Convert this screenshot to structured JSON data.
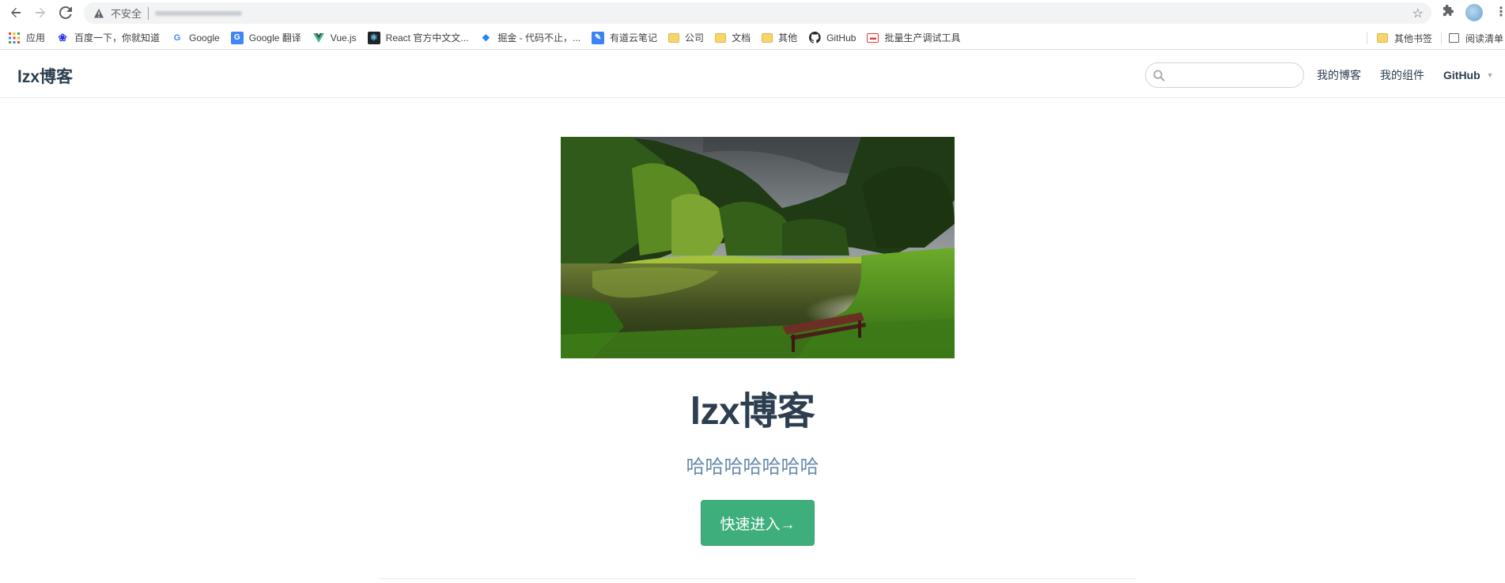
{
  "browser": {
    "insecure_label": "不安全",
    "icons": {
      "back": "back-arrow-icon",
      "forward": "forward-arrow-icon",
      "reload": "reload-icon",
      "warning": "warning-triangle-icon",
      "star": "star-icon",
      "extensions": "puzzle-icon",
      "menu": "kebab-menu-icon"
    }
  },
  "bookmarks": {
    "items": [
      {
        "label": "应用",
        "icon": "apps-grid-icon"
      },
      {
        "label": "百度一下，你就知道",
        "icon": "baidu-icon"
      },
      {
        "label": "Google",
        "icon": "google-icon"
      },
      {
        "label": "Google 翻译",
        "icon": "google-translate-icon"
      },
      {
        "label": "Vue.js",
        "icon": "vue-icon"
      },
      {
        "label": "React 官方中文文...",
        "icon": "react-icon"
      },
      {
        "label": "掘金 - 代码不止，...",
        "icon": "juejin-icon"
      },
      {
        "label": "有道云笔记",
        "icon": "youdao-icon"
      },
      {
        "label": "公司",
        "icon": "folder-icon"
      },
      {
        "label": "文档",
        "icon": "folder-icon"
      },
      {
        "label": "其他",
        "icon": "folder-icon"
      },
      {
        "label": "GitHub",
        "icon": "github-icon"
      },
      {
        "label": "批量生产调试工具",
        "icon": "tool-icon"
      }
    ],
    "other_bookmarks": "其他书签",
    "reading_list": "阅读清单"
  },
  "navbar": {
    "site_title": "lzx博客",
    "search_placeholder": "",
    "links": {
      "blog": "我的博客",
      "components": "我的组件",
      "github": "GitHub"
    }
  },
  "hero": {
    "title": "lzx博客",
    "description": "哈哈哈哈哈哈哈",
    "action_text": "快速进入→",
    "image": "forest-lake-landscape"
  },
  "colors": {
    "accent": "#3eaf7c",
    "text": "#2c3e50",
    "description": "#6a8bad"
  }
}
